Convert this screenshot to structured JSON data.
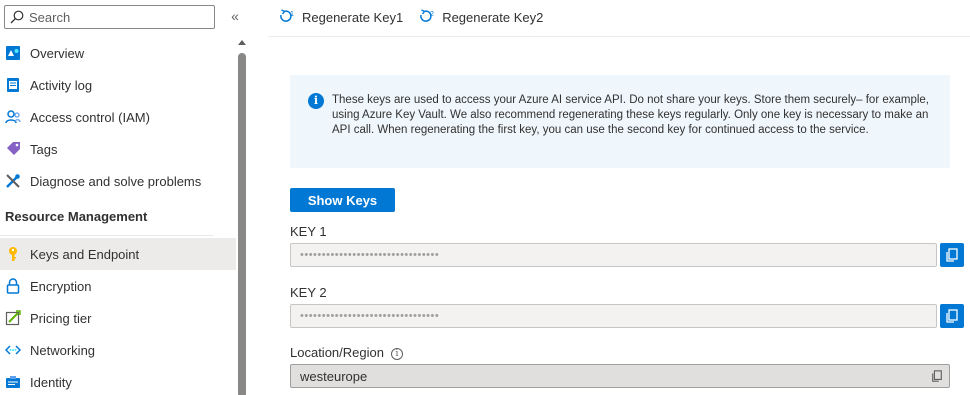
{
  "sidebar": {
    "search_placeholder": "Search",
    "collapse_glyph": "«",
    "items_top": [
      {
        "label": "Overview",
        "icon": "overview-icon"
      },
      {
        "label": "Activity log",
        "icon": "activity-log-icon"
      },
      {
        "label": "Access control (IAM)",
        "icon": "access-control-icon"
      },
      {
        "label": "Tags",
        "icon": "tag-icon"
      },
      {
        "label": "Diagnose and solve problems",
        "icon": "wrench-icon"
      }
    ],
    "section_header": "Resource Management",
    "items_bottom": [
      {
        "label": "Keys and Endpoint",
        "icon": "key-icon",
        "selected": true
      },
      {
        "label": "Encryption",
        "icon": "lock-icon"
      },
      {
        "label": "Pricing tier",
        "icon": "pricing-tier-icon"
      },
      {
        "label": "Networking",
        "icon": "networking-icon"
      },
      {
        "label": "Identity",
        "icon": "identity-icon"
      }
    ]
  },
  "toolbar": {
    "regenerate_key1": "Regenerate Key1",
    "regenerate_key2": "Regenerate Key2"
  },
  "info": {
    "glyph": "i",
    "text": "These keys are used to access your Azure AI service API. Do not share your keys. Store them securely– for example, using Azure Key Vault. We also recommend regenerating these keys regularly. Only one key is necessary to make an API call. When regenerating the first key, you can use the second key for continued access to the service."
  },
  "show_keys_label": "Show Keys",
  "key1": {
    "label": "KEY 1",
    "value": "••••••••••••••••••••••••••••••••"
  },
  "key2": {
    "label": "KEY 2",
    "value": "••••••••••••••••••••••••••••••••"
  },
  "location": {
    "label": "Location/Region",
    "info_glyph": "i",
    "value": "westeurope"
  },
  "colors": {
    "accent": "#0078d4",
    "selected_bg": "#edebe9",
    "info_bg": "#eff6fc"
  }
}
